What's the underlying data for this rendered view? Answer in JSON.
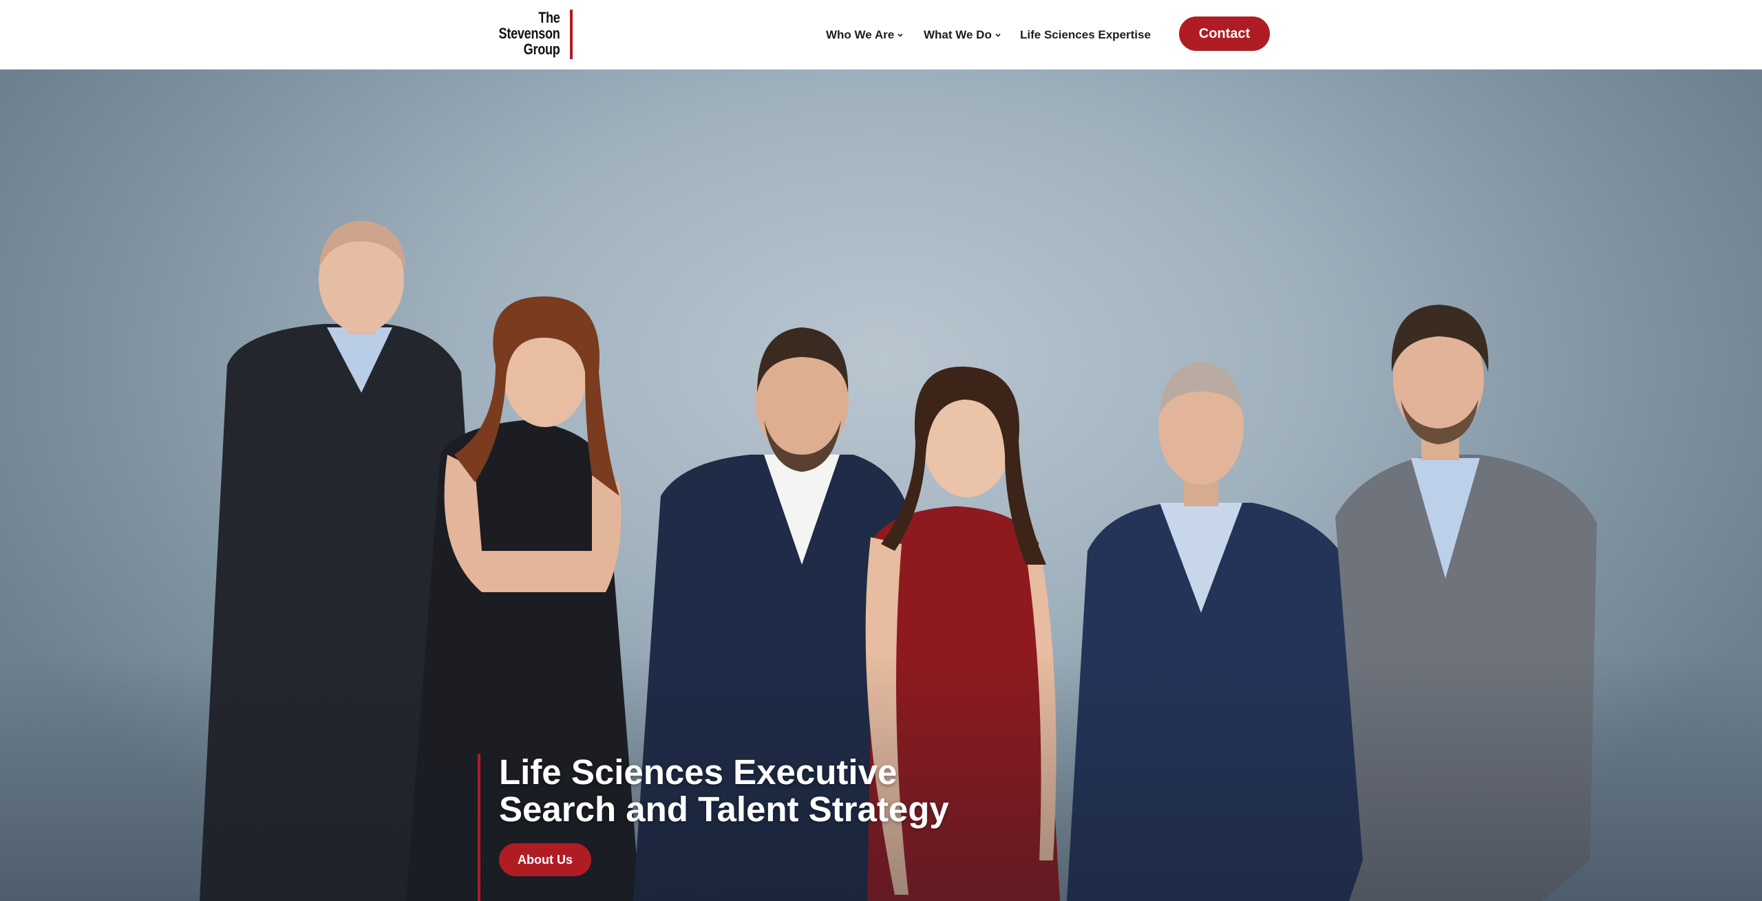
{
  "brand": {
    "logo_lines": [
      "The",
      "Stevenson",
      "Group"
    ],
    "accent_color": "#b01c24"
  },
  "nav": {
    "items": [
      {
        "label": "Who We Are",
        "has_dropdown": true
      },
      {
        "label": "What We Do",
        "has_dropdown": true
      },
      {
        "label": "Life Sciences Expertise",
        "has_dropdown": false
      }
    ],
    "contact_label": "Contact"
  },
  "hero": {
    "image": "team-group-portrait",
    "title_lines": [
      "Life Sciences Executive",
      "Search and Talent Strategy"
    ],
    "button_label": "About Us"
  }
}
